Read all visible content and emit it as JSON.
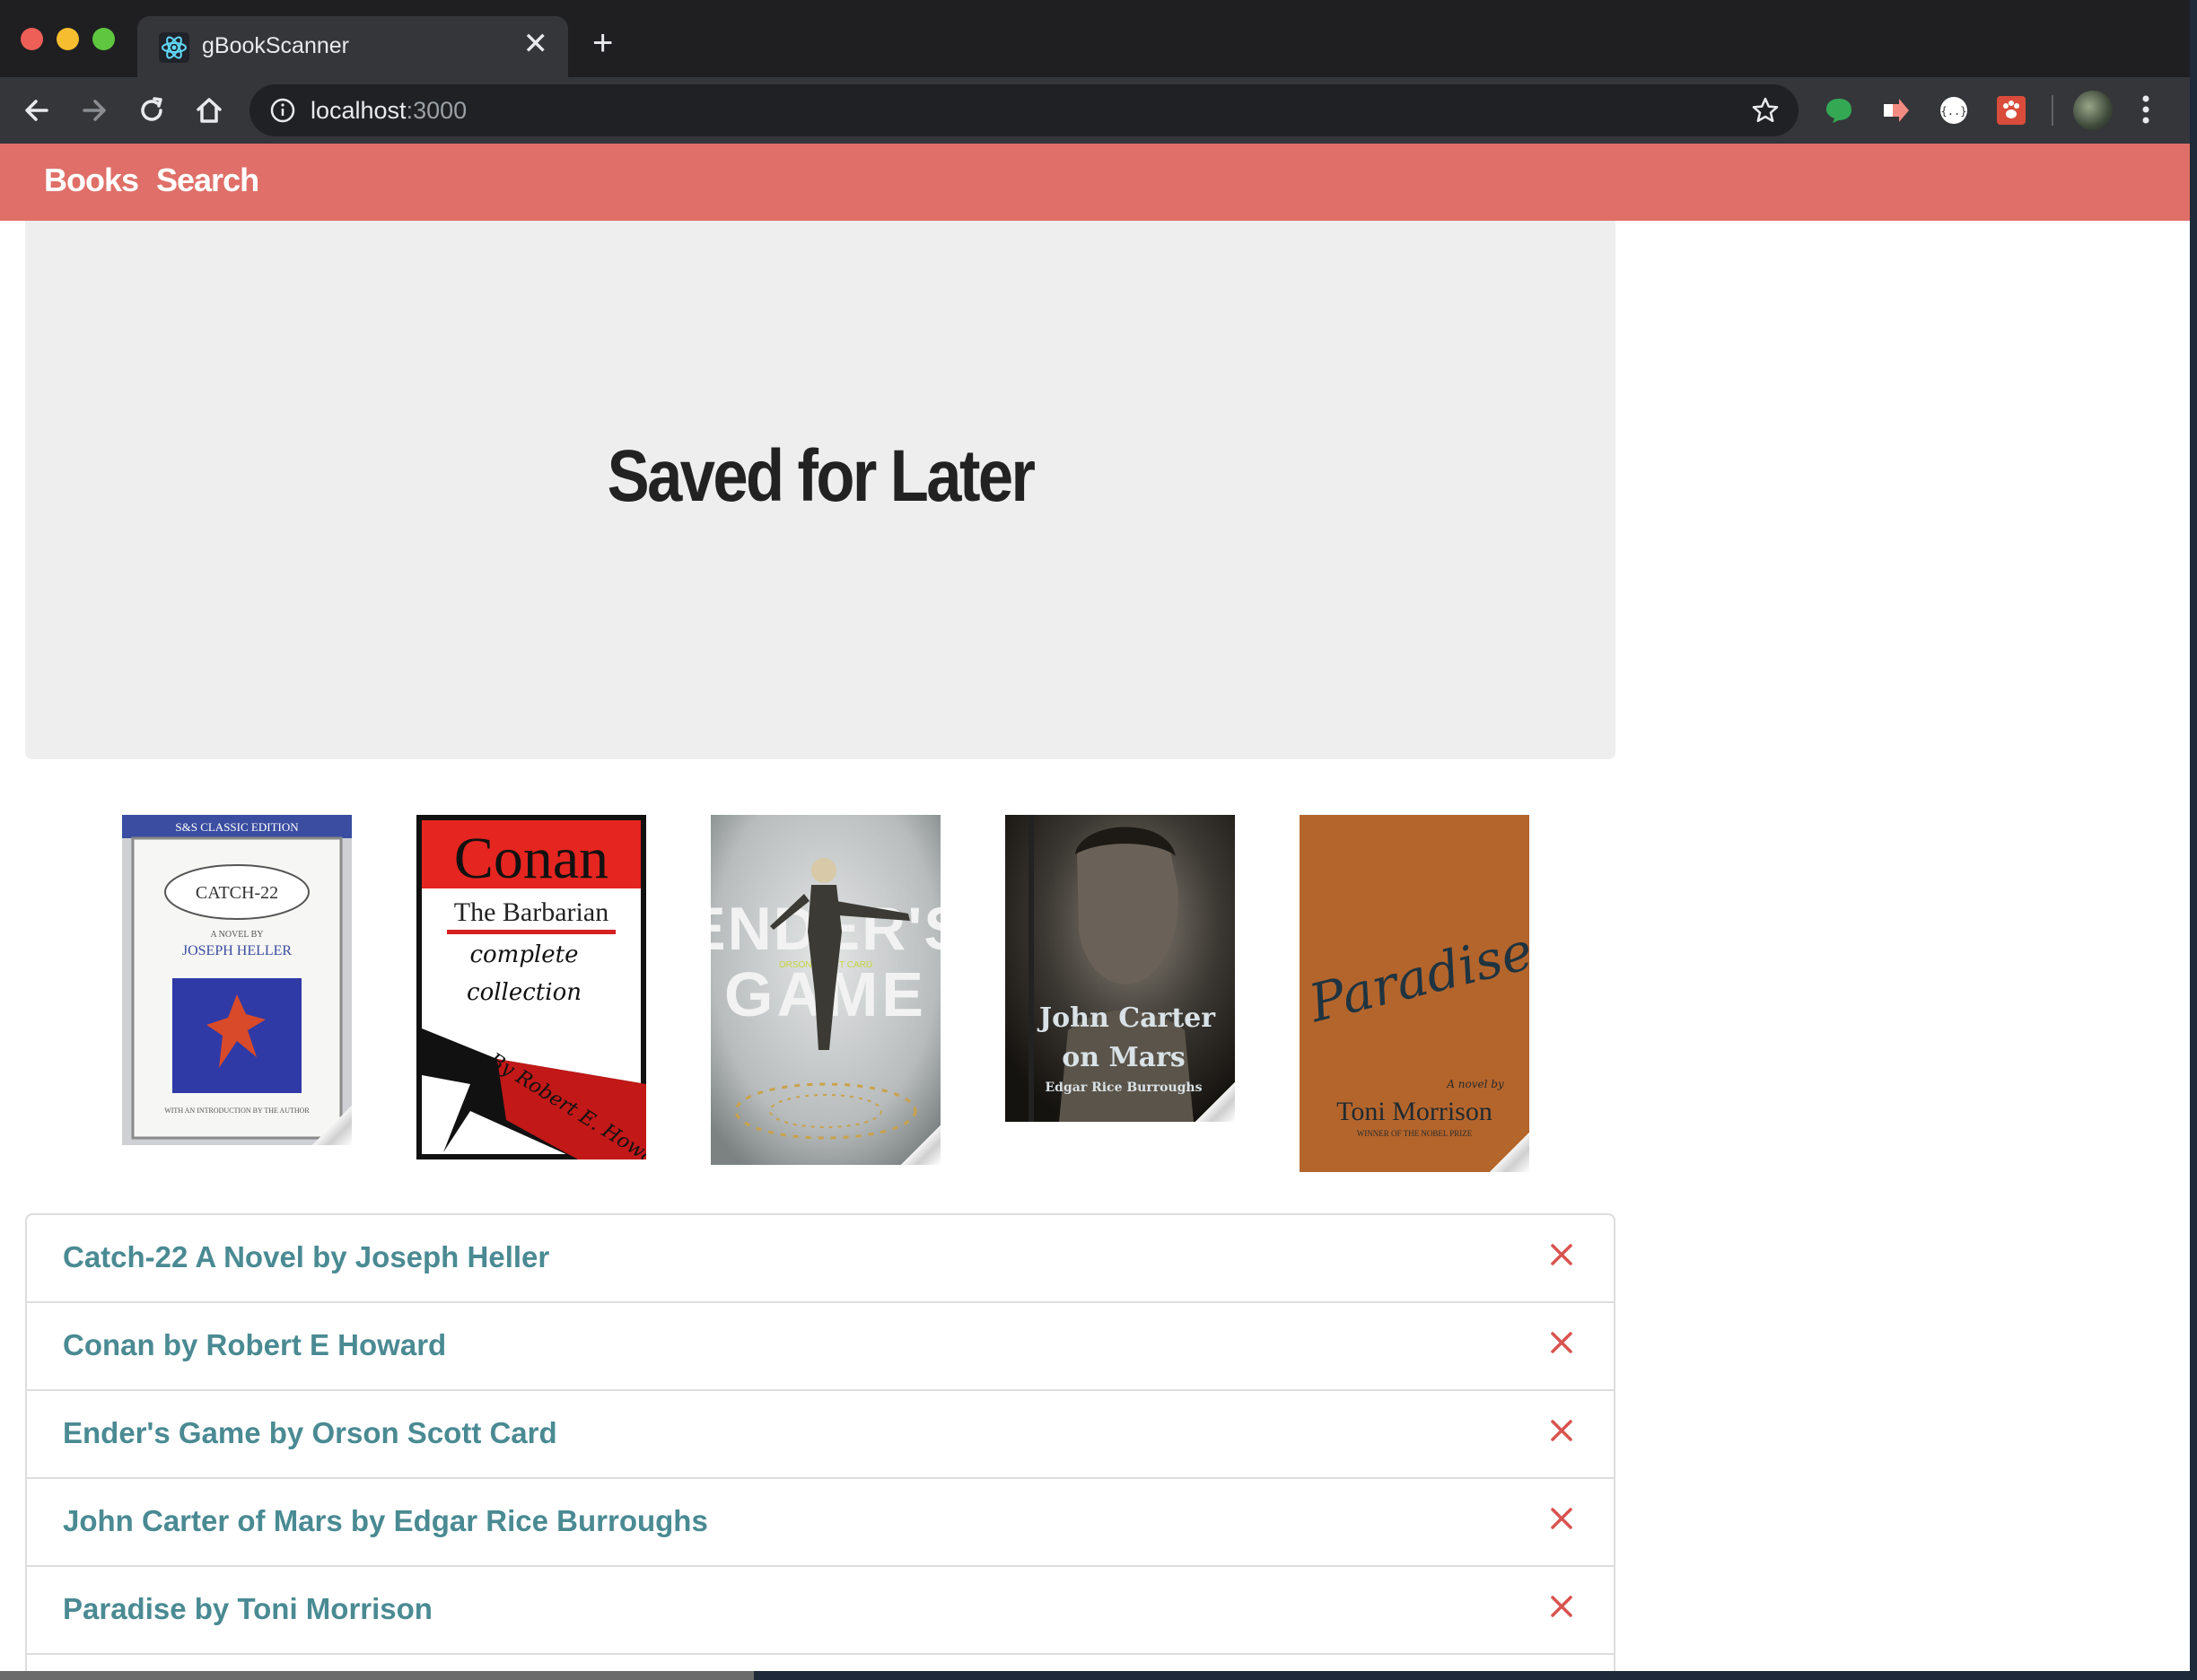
{
  "browser": {
    "tab_title": "gBookScanner",
    "url_host": "localhost",
    "url_port": ":3000"
  },
  "app": {
    "nav": {
      "books": "Books",
      "search": "Search"
    },
    "hero_title": "Saved for Later",
    "books": [
      {
        "title": "Catch-22 A Novel by Joseph Heller",
        "cover_alt": "Catch-22 cover"
      },
      {
        "title": "Conan by Robert E Howard",
        "cover_alt": "Conan cover"
      },
      {
        "title": "Ender's Game by Orson Scott Card",
        "cover_alt": "Ender's Game cover"
      },
      {
        "title": "John Carter of Mars by Edgar Rice Burroughs",
        "cover_alt": "John Carter cover"
      },
      {
        "title": "Paradise by Toni Morrison",
        "cover_alt": "Paradise cover"
      }
    ],
    "remove_icon": "close-icon",
    "colors": {
      "nav": "#df6f68",
      "link": "#4a8a93",
      "remove": "#d9534f"
    }
  },
  "covers": {
    "catch22": {
      "series": "S&S CLASSIC EDITION",
      "title": "CATCH-22",
      "subtitle": "A NOVEL BY",
      "author": "JOSEPH HELLER",
      "footer": "WITH AN INTRODUCTION BY THE AUTHOR"
    },
    "conan": {
      "title": "Conan",
      "subtitle": "The Barbarian",
      "line1": "complete",
      "line2": "collection",
      "author": "By Robert E. Howard"
    },
    "enders": {
      "title1": "ENDER'S",
      "title2": "GAME",
      "author": "ORSON SCOTT CARD"
    },
    "john_carter": {
      "title1": "John Carter",
      "title2": "on Mars",
      "author": "Edgar Rice Burroughs"
    },
    "paradise": {
      "title": "Paradise",
      "byline": "A novel by",
      "author": "Toni Morrison",
      "line2": "WINNER OF THE NOBEL PRIZE"
    }
  }
}
